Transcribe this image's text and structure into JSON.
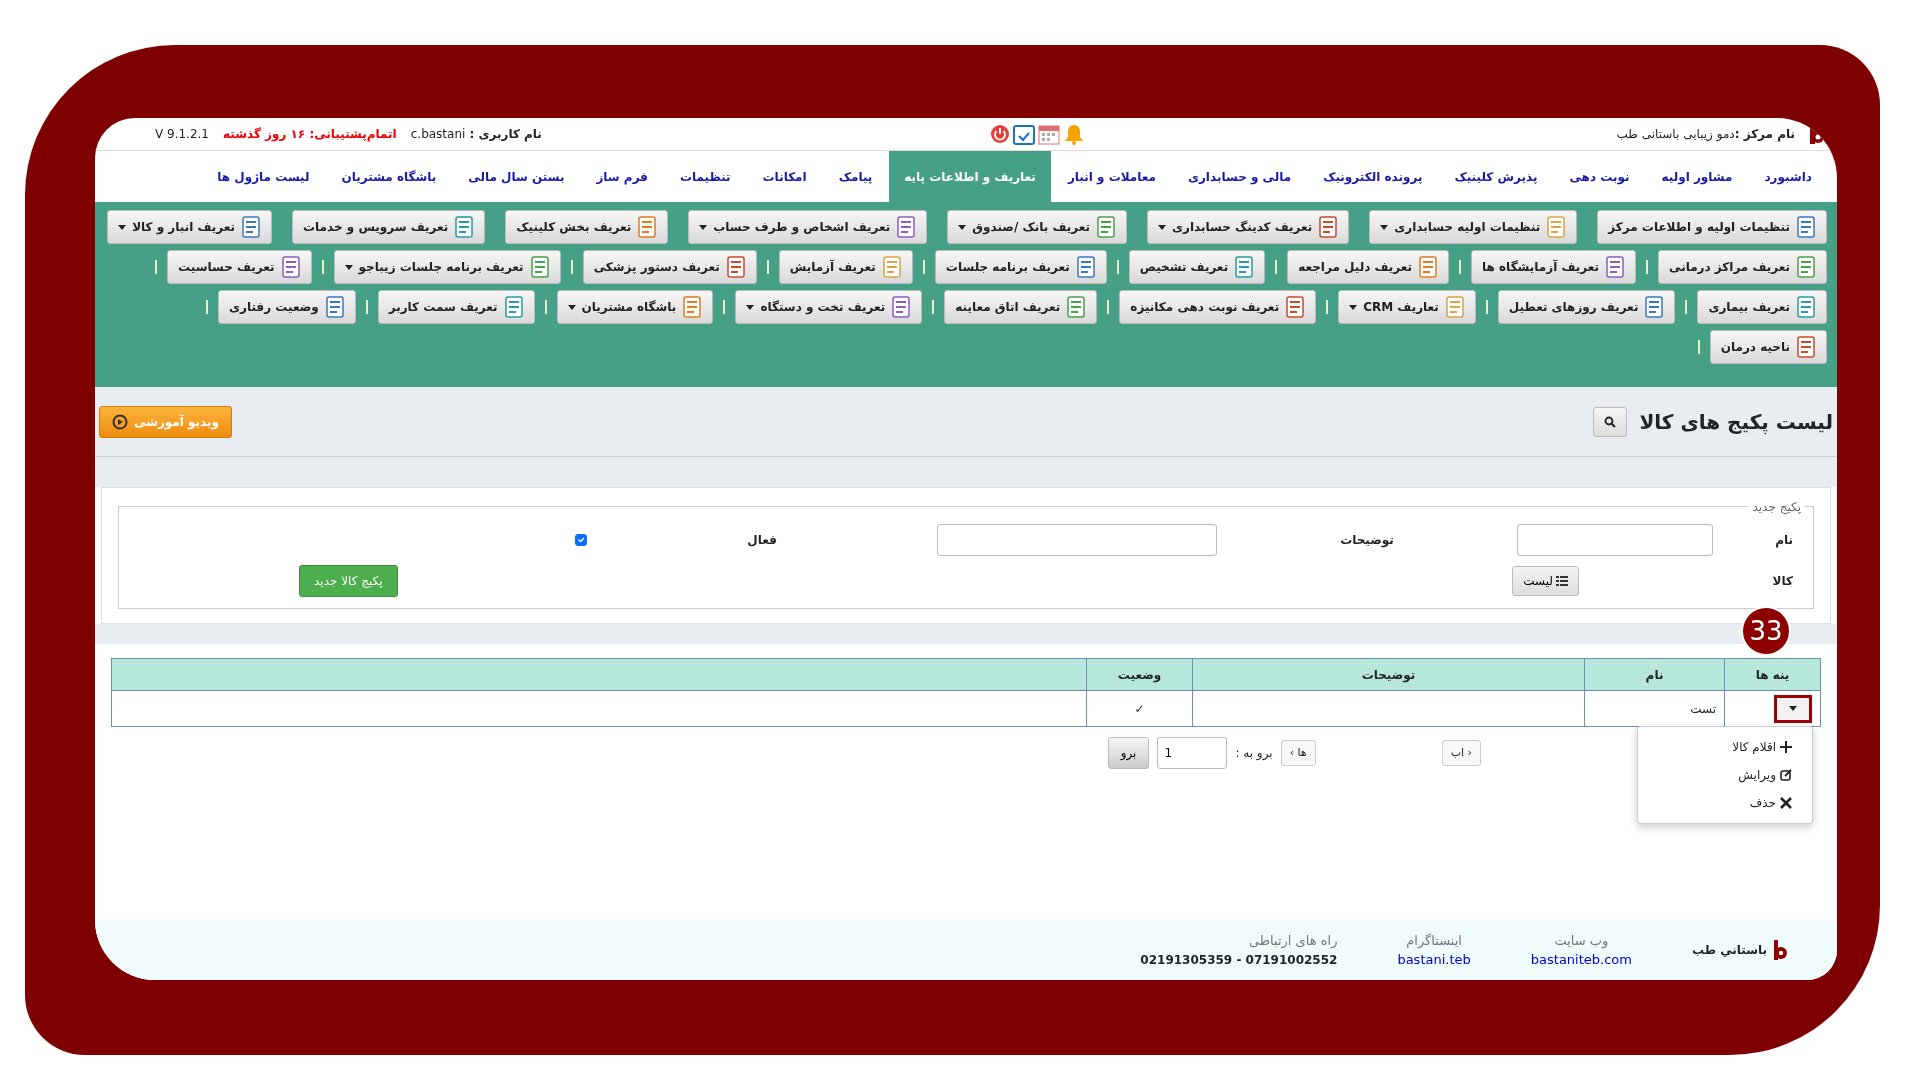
{
  "top_bar": {
    "center_label": "نام مرکز :",
    "center_name": "دمو زیبایی باستانی طب",
    "user_label": "نام کاربری :",
    "user_name": "c.bastani",
    "support": "اتمام‌پشتیبانی: ۱۶ روز گذشته",
    "version": "V 9.1.2.1"
  },
  "nav_tabs": [
    {
      "label": "داشبورد",
      "selected": false
    },
    {
      "label": "مشاور اولیه",
      "selected": false
    },
    {
      "label": "نوبت دهی",
      "selected": false
    },
    {
      "label": "پذیرش کلینیک",
      "selected": false
    },
    {
      "label": "پرونده الکترونیک",
      "selected": false
    },
    {
      "label": "مالی و حسابداری",
      "selected": false
    },
    {
      "label": "معاملات و انبار",
      "selected": false
    },
    {
      "label": "تعاریف و اطلاعات پایه",
      "selected": true
    },
    {
      "label": "پیامک",
      "selected": false
    },
    {
      "label": "امکانات",
      "selected": false
    },
    {
      "label": "تنظیمات",
      "selected": false
    },
    {
      "label": "فرم ساز",
      "selected": false
    },
    {
      "label": "بستن سال مالی",
      "selected": false
    },
    {
      "label": "باشگاه مشتریان",
      "selected": false
    },
    {
      "label": "لیست ماژول ها",
      "selected": false
    }
  ],
  "toolbar_rows": [
    [
      {
        "label": "تنظیمات اولیه و اطلاعات مرکز",
        "dropdown": false
      },
      {
        "label": "تنظیمات اولیه حسابداری",
        "dropdown": true
      },
      {
        "label": "تعریف کدینگ حسابداری",
        "dropdown": true
      },
      {
        "label": "تعریف بانک /صندوق",
        "dropdown": true
      },
      {
        "label": "تعریف اشخاص و طرف حساب",
        "dropdown": true
      },
      {
        "label": "تعریف بخش کلینیک",
        "dropdown": false
      },
      {
        "label": "تعریف سرویس و خدمات",
        "dropdown": false
      },
      {
        "label": "تعریف انبار و کالا",
        "dropdown": true
      }
    ],
    [
      {
        "label": "تعریف مراکز درمانی",
        "dropdown": false
      },
      {
        "label": "تعریف آزمایشگاه ها",
        "dropdown": false
      },
      {
        "label": "تعریف دلیل مراجعه",
        "dropdown": false
      },
      {
        "label": "تعریف تشخیص",
        "dropdown": false
      },
      {
        "label": "تعریف برنامه جلسات",
        "dropdown": false
      },
      {
        "label": "تعریف آزمایش",
        "dropdown": false
      },
      {
        "label": "تعریف دستور پزشکی",
        "dropdown": false
      },
      {
        "label": "تعریف برنامه جلسات زیباجو",
        "dropdown": true
      },
      {
        "label": "تعریف حساسیت",
        "dropdown": false
      }
    ],
    [
      {
        "label": "تعریف بیماری",
        "dropdown": false
      },
      {
        "label": "تعریف روزهای تعطیل",
        "dropdown": false
      },
      {
        "label": "تعاریف CRM",
        "dropdown": true
      },
      {
        "label": "تعریف نوبت دهی مکانیزه",
        "dropdown": false
      },
      {
        "label": "تعریف اتاق معاینه",
        "dropdown": false
      },
      {
        "label": "تعریف تخت و دستگاه",
        "dropdown": true
      },
      {
        "label": "باشگاه مشتریان",
        "dropdown": true
      },
      {
        "label": "تعریف سمت کاربر",
        "dropdown": false
      },
      {
        "label": "وضعیت رفتاری",
        "dropdown": false
      }
    ],
    [
      {
        "label": "ناحیه درمان",
        "dropdown": false
      }
    ]
  ],
  "page_title": "لیست پکیج های کالا",
  "video_button": "ویدیو آموزشی",
  "form": {
    "legend": "پکیج جدید",
    "name_label": "نام",
    "desc_label": "توضیحات",
    "active_label": "فعال",
    "active_checked": true,
    "goods_label": "کالا",
    "list_button": "لیست",
    "submit_button": "پکیج کالا جدید"
  },
  "table": {
    "columns": [
      "ینه ها",
      "نام",
      "توضیحات",
      "وضعیت"
    ],
    "rows": [
      {
        "name": "تست",
        "description": "",
        "status": "✓"
      }
    ]
  },
  "step_badge": "33",
  "row_menu": [
    {
      "kind": "add",
      "label": "اقلام کالا"
    },
    {
      "kind": "edit",
      "label": "ویرایش"
    },
    {
      "kind": "delete",
      "label": "حذف"
    }
  ],
  "pager": {
    "prev_fragment": "‹ اب",
    "next_fragment": "ها ›",
    "goto_label": "برو به :",
    "page": "1",
    "go_button": "برو"
  },
  "footer": {
    "brand": "باستاني طب",
    "website_label": "وب سایت",
    "website": "bastaniteb.com",
    "instagram_label": "اینستاگرام",
    "instagram": "bastani.teb",
    "contact_label": "راه های ارتباطی",
    "contact": "07191002552 - 02191305359"
  }
}
